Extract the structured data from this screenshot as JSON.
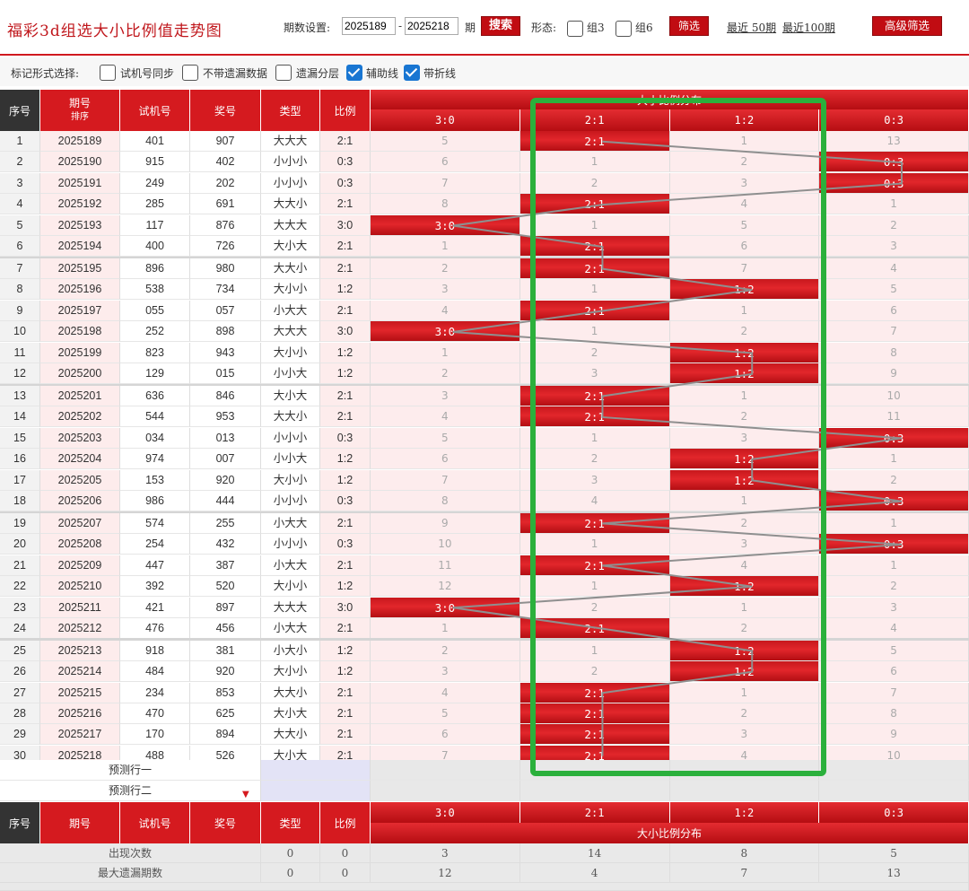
{
  "header": {
    "title": "福彩3d组选大小比例值走势图",
    "period_label": "期数设置:",
    "from": "2025189",
    "dash": "-",
    "to": "2025218",
    "unit": "期",
    "search": "搜索",
    "form_label": "形态:",
    "opt_z3": "组3",
    "opt_z6": "组6",
    "filter": "筛选",
    "recent50": "最近 50期",
    "recent100": "最近100期",
    "advanced": "高级筛选"
  },
  "marks": {
    "label": "标记形式选择:",
    "options": [
      {
        "label": "试机号同步",
        "checked": false
      },
      {
        "label": "不带遗漏数据",
        "checked": false
      },
      {
        "label": "遗漏分层",
        "checked": false
      },
      {
        "label": "辅助线",
        "checked": true
      },
      {
        "label": "带折线",
        "checked": true
      }
    ]
  },
  "columns": {
    "idx": "序号",
    "issue": "期号",
    "sort": "排序",
    "trial": "试机号",
    "draw": "奖号",
    "type": "类型",
    "ratio": "比例",
    "dist": "大小比例分布"
  },
  "dist_cols": [
    "3:0",
    "2:1",
    "1:2",
    "0:3"
  ],
  "rows": [
    {
      "i": "1",
      "issue": "2025189",
      "trial": "401",
      "draw": "907",
      "type": "大大大",
      "ratio": "2:1",
      "d": [
        "5",
        "2:1",
        "1",
        "13"
      ],
      "h": 1
    },
    {
      "i": "2",
      "issue": "2025190",
      "trial": "915",
      "draw": "402",
      "type": "小小小",
      "ratio": "0:3",
      "d": [
        "6",
        "1",
        "2",
        "0:3"
      ],
      "h": 3
    },
    {
      "i": "3",
      "issue": "2025191",
      "trial": "249",
      "draw": "202",
      "type": "小小小",
      "ratio": "0:3",
      "d": [
        "7",
        "2",
        "3",
        "0:3"
      ],
      "h": 3
    },
    {
      "i": "4",
      "issue": "2025192",
      "trial": "285",
      "draw": "691",
      "type": "大大小",
      "ratio": "2:1",
      "d": [
        "8",
        "2:1",
        "4",
        "1"
      ],
      "h": 1
    },
    {
      "i": "5",
      "issue": "2025193",
      "trial": "117",
      "draw": "876",
      "type": "大大大",
      "ratio": "3:0",
      "d": [
        "3:0",
        "1",
        "5",
        "2"
      ],
      "h": 0
    },
    {
      "i": "6",
      "issue": "2025194",
      "trial": "400",
      "draw": "726",
      "type": "大小大",
      "ratio": "2:1",
      "d": [
        "1",
        "2:1",
        "6",
        "3"
      ],
      "h": 1
    },
    {
      "i": "7",
      "issue": "2025195",
      "trial": "896",
      "draw": "980",
      "type": "大大小",
      "ratio": "2:1",
      "d": [
        "2",
        "2:1",
        "7",
        "4"
      ],
      "h": 1
    },
    {
      "i": "8",
      "issue": "2025196",
      "trial": "538",
      "draw": "734",
      "type": "大小小",
      "ratio": "1:2",
      "d": [
        "3",
        "1",
        "1:2",
        "5"
      ],
      "h": 2
    },
    {
      "i": "9",
      "issue": "2025197",
      "trial": "055",
      "draw": "057",
      "type": "小大大",
      "ratio": "2:1",
      "d": [
        "4",
        "2:1",
        "1",
        "6"
      ],
      "h": 1
    },
    {
      "i": "10",
      "issue": "2025198",
      "trial": "252",
      "draw": "898",
      "type": "大大大",
      "ratio": "3:0",
      "d": [
        "3:0",
        "1",
        "2",
        "7"
      ],
      "h": 0
    },
    {
      "i": "11",
      "issue": "2025199",
      "trial": "823",
      "draw": "943",
      "type": "大小小",
      "ratio": "1:2",
      "d": [
        "1",
        "2",
        "1:2",
        "8"
      ],
      "h": 2
    },
    {
      "i": "12",
      "issue": "2025200",
      "trial": "129",
      "draw": "015",
      "type": "小小大",
      "ratio": "1:2",
      "d": [
        "2",
        "3",
        "1:2",
        "9"
      ],
      "h": 2
    },
    {
      "i": "13",
      "issue": "2025201",
      "trial": "636",
      "draw": "846",
      "type": "大小大",
      "ratio": "2:1",
      "d": [
        "3",
        "2:1",
        "1",
        "10"
      ],
      "h": 1
    },
    {
      "i": "14",
      "issue": "2025202",
      "trial": "544",
      "draw": "953",
      "type": "大大小",
      "ratio": "2:1",
      "d": [
        "4",
        "2:1",
        "2",
        "11"
      ],
      "h": 1
    },
    {
      "i": "15",
      "issue": "2025203",
      "trial": "034",
      "draw": "013",
      "type": "小小小",
      "ratio": "0:3",
      "d": [
        "5",
        "1",
        "3",
        "0:3"
      ],
      "h": 3
    },
    {
      "i": "16",
      "issue": "2025204",
      "trial": "974",
      "draw": "007",
      "type": "小小大",
      "ratio": "1:2",
      "d": [
        "6",
        "2",
        "1:2",
        "1"
      ],
      "h": 2
    },
    {
      "i": "17",
      "issue": "2025205",
      "trial": "153",
      "draw": "920",
      "type": "大小小",
      "ratio": "1:2",
      "d": [
        "7",
        "3",
        "1:2",
        "2"
      ],
      "h": 2
    },
    {
      "i": "18",
      "issue": "2025206",
      "trial": "986",
      "draw": "444",
      "type": "小小小",
      "ratio": "0:3",
      "d": [
        "8",
        "4",
        "1",
        "0:3"
      ],
      "h": 3
    },
    {
      "i": "19",
      "issue": "2025207",
      "trial": "574",
      "draw": "255",
      "type": "小大大",
      "ratio": "2:1",
      "d": [
        "9",
        "2:1",
        "2",
        "1"
      ],
      "h": 1
    },
    {
      "i": "20",
      "issue": "2025208",
      "trial": "254",
      "draw": "432",
      "type": "小小小",
      "ratio": "0:3",
      "d": [
        "10",
        "1",
        "3",
        "0:3"
      ],
      "h": 3
    },
    {
      "i": "21",
      "issue": "2025209",
      "trial": "447",
      "draw": "387",
      "type": "小大大",
      "ratio": "2:1",
      "d": [
        "11",
        "2:1",
        "4",
        "1"
      ],
      "h": 1
    },
    {
      "i": "22",
      "issue": "2025210",
      "trial": "392",
      "draw": "520",
      "type": "大小小",
      "ratio": "1:2",
      "d": [
        "12",
        "1",
        "1:2",
        "2"
      ],
      "h": 2
    },
    {
      "i": "23",
      "issue": "2025211",
      "trial": "421",
      "draw": "897",
      "type": "大大大",
      "ratio": "3:0",
      "d": [
        "3:0",
        "2",
        "1",
        "3"
      ],
      "h": 0
    },
    {
      "i": "24",
      "issue": "2025212",
      "trial": "476",
      "draw": "456",
      "type": "小大大",
      "ratio": "2:1",
      "d": [
        "1",
        "2:1",
        "2",
        "4"
      ],
      "h": 1
    },
    {
      "i": "25",
      "issue": "2025213",
      "trial": "918",
      "draw": "381",
      "type": "小大小",
      "ratio": "1:2",
      "d": [
        "2",
        "1",
        "1:2",
        "5"
      ],
      "h": 2
    },
    {
      "i": "26",
      "issue": "2025214",
      "trial": "484",
      "draw": "920",
      "type": "大小小",
      "ratio": "1:2",
      "d": [
        "3",
        "2",
        "1:2",
        "6"
      ],
      "h": 2
    },
    {
      "i": "27",
      "issue": "2025215",
      "trial": "234",
      "draw": "853",
      "type": "大大小",
      "ratio": "2:1",
      "d": [
        "4",
        "2:1",
        "1",
        "7"
      ],
      "h": 1
    },
    {
      "i": "28",
      "issue": "2025216",
      "trial": "470",
      "draw": "625",
      "type": "大小大",
      "ratio": "2:1",
      "d": [
        "5",
        "2:1",
        "2",
        "8"
      ],
      "h": 1
    },
    {
      "i": "29",
      "issue": "2025217",
      "trial": "170",
      "draw": "894",
      "type": "大大小",
      "ratio": "2:1",
      "d": [
        "6",
        "2:1",
        "3",
        "9"
      ],
      "h": 1
    },
    {
      "i": "30",
      "issue": "2025218",
      "trial": "488",
      "draw": "526",
      "type": "大小大",
      "ratio": "2:1",
      "d": [
        "7",
        "2:1",
        "4",
        "10"
      ],
      "h": 1
    }
  ],
  "predict": [
    "预测行一",
    "预测行二"
  ],
  "stats": [
    {
      "label": "出现次数",
      "type": "0",
      "ratio": "0",
      "vals": [
        "3",
        "14",
        "8",
        "5"
      ]
    },
    {
      "label": "最大遗漏期数",
      "type": "0",
      "ratio": "0",
      "vals": [
        "12",
        "4",
        "7",
        "13"
      ]
    }
  ],
  "colors": {
    "accent": "#d51a1f",
    "highlight_box": "#2bb03c"
  }
}
